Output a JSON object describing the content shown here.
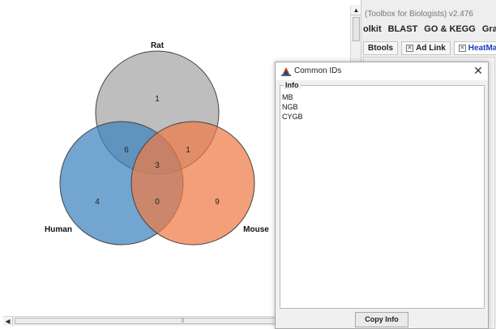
{
  "venn": {
    "sets": [
      {
        "name": "Rat",
        "color": "#a8a8a8"
      },
      {
        "name": "Human",
        "color": "#3b82bd"
      },
      {
        "name": "Mouse",
        "color": "#ee7a45"
      }
    ],
    "regions": {
      "rat_only": "1",
      "human_only": "4",
      "mouse_only": "9",
      "human_rat": "6",
      "rat_mouse": "1",
      "human_mouse": "0",
      "all_three": "3"
    }
  },
  "background_app": {
    "title": "(Toolbox for Biologists) v2.476",
    "menu": [
      "olkit",
      "BLAST",
      "GO & KEGG",
      "Grap"
    ],
    "tabs": [
      "Btools",
      "Ad Link",
      "HeatMap"
    ],
    "active_tab_color": "#1a3fbf"
  },
  "dialog": {
    "title": "Common IDs",
    "group_label": "Info",
    "ids": [
      "MB",
      "NGB",
      "CYGB"
    ],
    "copy_button": "Copy Info"
  },
  "icons": {
    "close": "close-icon",
    "app": "app-icon",
    "scroll_up": "arrow-up-icon",
    "scroll_left": "arrow-left-icon"
  }
}
